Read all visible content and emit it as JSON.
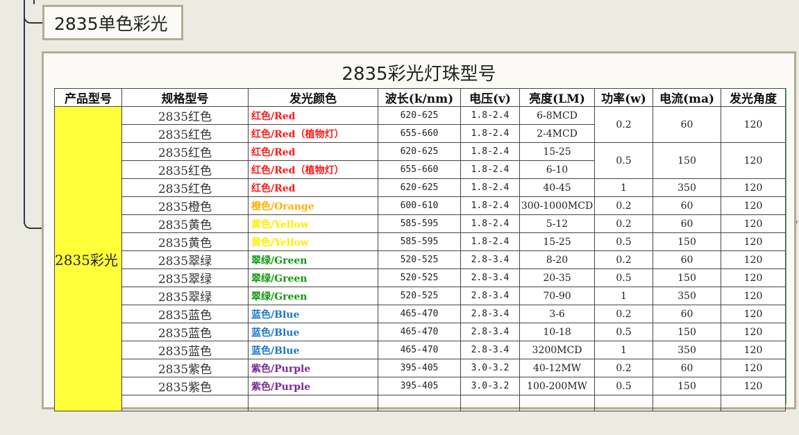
{
  "topic": {
    "label": "2835单色彩光"
  },
  "card": {
    "title": "2835彩光灯珠型号"
  },
  "table": {
    "headers": [
      "产品型号",
      "规格型号",
      "发光颜色",
      "波长(k/nm)",
      "电压(v)",
      "亮度(LM)",
      "功率(w)",
      "电流(ma)",
      "发光角度"
    ],
    "model": "2835彩光",
    "colors": {
      "red": "#ff1a1a",
      "orange": "#ffb000",
      "yellow": "#ffee00",
      "green": "#119911",
      "blue": "#1a78c8",
      "purple": "#7a2a9a",
      "model_bg": "#ffff3a",
      "frame": "#b2ad92"
    },
    "rows": [
      {
        "spec": "2835红色",
        "color": "红色/Red",
        "tone": "red",
        "wave": "620-625",
        "volt": "1.8-2.4",
        "lum": "6-8MCD",
        "power": "0.2",
        "current": "60",
        "angle": "120"
      },
      {
        "spec": "2835红色",
        "color": "红色/Red（植物灯）",
        "tone": "red",
        "wave": "655-660",
        "volt": "1.8-2.4",
        "lum": "2-4MCD"
      },
      {
        "spec": "2835红色",
        "color": "红色/Red",
        "tone": "red",
        "wave": "620-625",
        "volt": "1.8-2.4",
        "lum": "15-25",
        "power": "0.5",
        "current": "150",
        "angle": "120"
      },
      {
        "spec": "2835红色",
        "color": "红色/Red（植物灯）",
        "tone": "red",
        "wave": "655-660",
        "volt": "1.8-2.4",
        "lum": "6-10"
      },
      {
        "spec": "2835红色",
        "color": "红色/Red",
        "tone": "red",
        "wave": "620-625",
        "volt": "1.8-2.4",
        "lum": "40-45",
        "power": "1",
        "current": "350",
        "angle": "120"
      },
      {
        "spec": "2835橙色",
        "color": "橙色/Orange",
        "tone": "orange",
        "wave": "600-610",
        "volt": "1.8-2.4",
        "lum": "300-1000MCD",
        "power": "0.2",
        "current": "60",
        "angle": "120"
      },
      {
        "spec": "2835黄色",
        "color": "黄色/Yellow",
        "tone": "yellow",
        "wave": "585-595",
        "volt": "1.8-2.4",
        "lum": "5-12",
        "power": "0.2",
        "current": "60",
        "angle": "120"
      },
      {
        "spec": "2835黄色",
        "color": "黄色/Yellow",
        "tone": "yellow",
        "wave": "585-595",
        "volt": "1.8-2.4",
        "lum": "15-25",
        "power": "0.5",
        "current": "150",
        "angle": "120"
      },
      {
        "spec": "2835翠绿",
        "color": "翠绿/Green",
        "tone": "green",
        "wave": "520-525",
        "volt": "2.8-3.4",
        "lum": "8-20",
        "power": "0.2",
        "current": "60",
        "angle": "120"
      },
      {
        "spec": "2835翠绿",
        "color": "翠绿/Green",
        "tone": "green",
        "wave": "520-525",
        "volt": "2.8-3.4",
        "lum": "20-35",
        "power": "0.5",
        "current": "150",
        "angle": "120"
      },
      {
        "spec": "2835翠绿",
        "color": "翠绿/Green",
        "tone": "green",
        "wave": "520-525",
        "volt": "2.8-3.4",
        "lum": "70-90",
        "power": "1",
        "current": "350",
        "angle": "120"
      },
      {
        "spec": "2835蓝色",
        "color": "蓝色/Blue",
        "tone": "blue",
        "wave": "465-470",
        "volt": "2.8-3.4",
        "lum": "3-6",
        "power": "0.2",
        "current": "60",
        "angle": "120"
      },
      {
        "spec": "2835蓝色",
        "color": "蓝色/Blue",
        "tone": "blue",
        "wave": "465-470",
        "volt": "2.8-3.4",
        "lum": "10-18",
        "power": "0.5",
        "current": "150",
        "angle": "120"
      },
      {
        "spec": "2835蓝色",
        "color": "蓝色/Blue",
        "tone": "blue",
        "wave": "465-470",
        "volt": "2.8-3.4",
        "lum": "3200MCD",
        "power": "1",
        "current": "350",
        "angle": "120"
      },
      {
        "spec": "2835紫色",
        "color": "紫色/Purple",
        "tone": "purple",
        "wave": "395-405",
        "volt": "3.0-3.2",
        "lum": "40-12MW",
        "power": "0.2",
        "current": "60",
        "angle": "120"
      },
      {
        "spec": "2835紫色",
        "color": "紫色/Purple",
        "tone": "purple",
        "wave": "395-405",
        "volt": "3.0-3.2",
        "lum": "100-200MW",
        "power": "0.5",
        "current": "150",
        "angle": "120"
      }
    ]
  }
}
